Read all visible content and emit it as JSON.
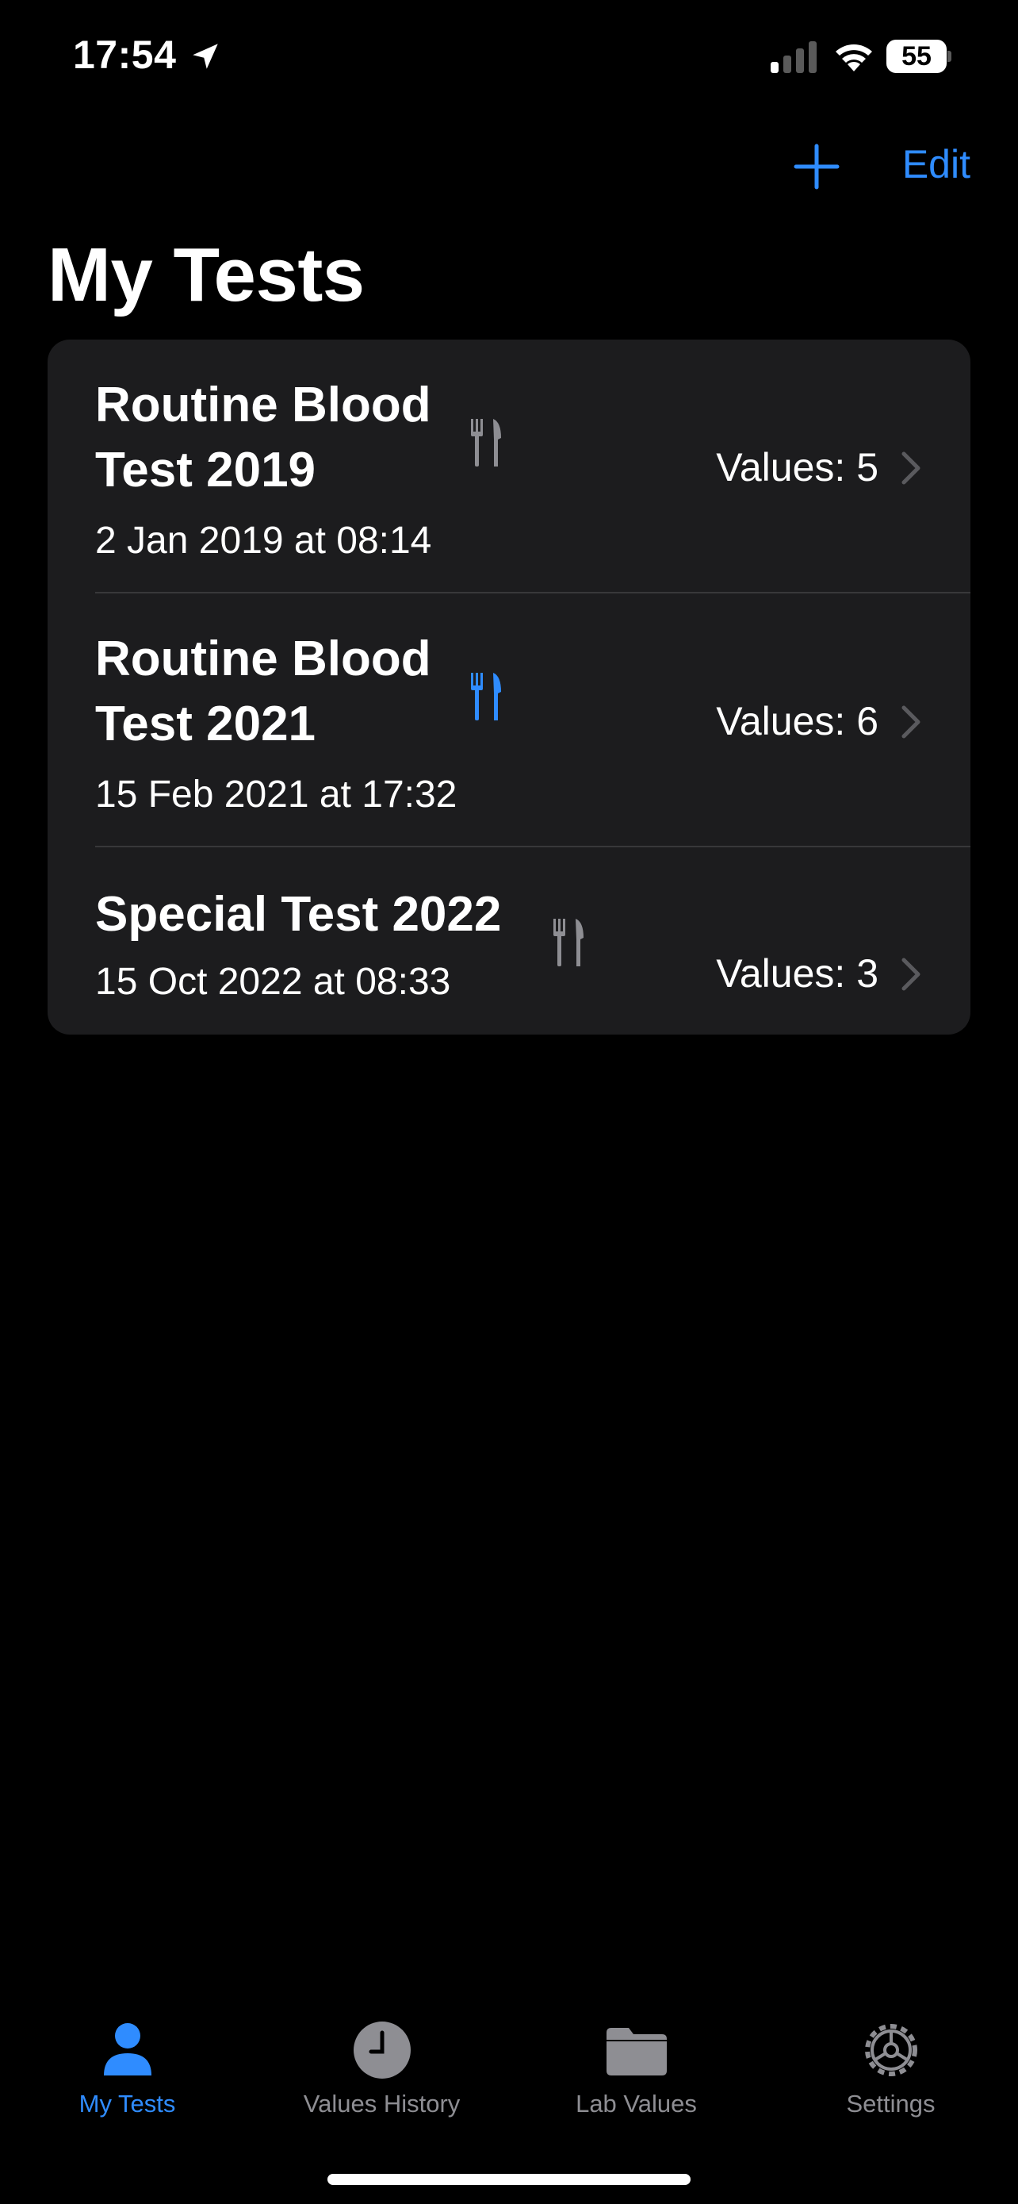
{
  "status_bar": {
    "time": "17:54",
    "battery": "55"
  },
  "nav": {
    "edit_label": "Edit"
  },
  "page_title": "My Tests",
  "tests": [
    {
      "title": "Routine Blood Test 2019",
      "date": "2 Jan 2019 at 08:14",
      "values": "Values: 5",
      "fasting_icon_color": "#8e8e93"
    },
    {
      "title": "Routine Blood Test 2021",
      "date": "15 Feb 2021 at 17:32",
      "values": "Values: 6",
      "fasting_icon_color": "#2f8cff"
    },
    {
      "title": "Special Test 2022",
      "date": "15 Oct 2022 at 08:33",
      "values": "Values: 3",
      "fasting_icon_color": "#8e8e93"
    }
  ],
  "tab_bar": {
    "items": [
      {
        "label": "My Tests",
        "icon": "person-icon",
        "active": true
      },
      {
        "label": "Values History",
        "icon": "clock-icon",
        "active": false
      },
      {
        "label": "Lab Values",
        "icon": "folder-icon",
        "active": false
      },
      {
        "label": "Settings",
        "icon": "gear-icon",
        "active": false
      }
    ]
  },
  "colors": {
    "accent": "#2f8cff",
    "background": "#000000",
    "card": "#1c1c1e",
    "secondary": "#8e8e93"
  }
}
